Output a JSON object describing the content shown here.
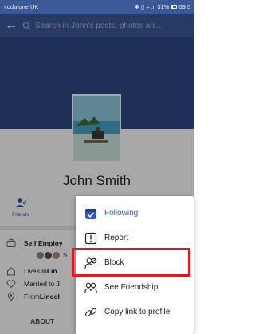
{
  "status_bar": {
    "carrier": "vodafone UK",
    "indicators": "✱ ▯ ≈ .ıl 31%",
    "time": "09:5"
  },
  "topbar": {
    "back_icon": "arrow-left-icon",
    "search_placeholder": "Search in John's posts, photos an..."
  },
  "profile": {
    "name": "John Smith"
  },
  "actions": {
    "friends_label": "Friends"
  },
  "info": {
    "work": "Self Employ",
    "mutual_friends": "S",
    "lives_in": "Lives in ",
    "lives_in_place": "Lin",
    "married_to": "Married to J",
    "from": "From ",
    "from_place": "Lincol",
    "about_label": "ABOUT"
  },
  "menu": {
    "items": [
      {
        "label": "Following",
        "icon": "following-icon"
      },
      {
        "label": "Report",
        "icon": "report-icon"
      },
      {
        "label": "Block",
        "icon": "block-user-icon"
      },
      {
        "label": "See Friendship",
        "icon": "friendship-icon"
      },
      {
        "label": "Copy link to profile",
        "icon": "link-icon"
      }
    ]
  },
  "colors": {
    "brand": "#3b5998",
    "accent": "#2f56b5",
    "highlight": "#e4151e"
  }
}
